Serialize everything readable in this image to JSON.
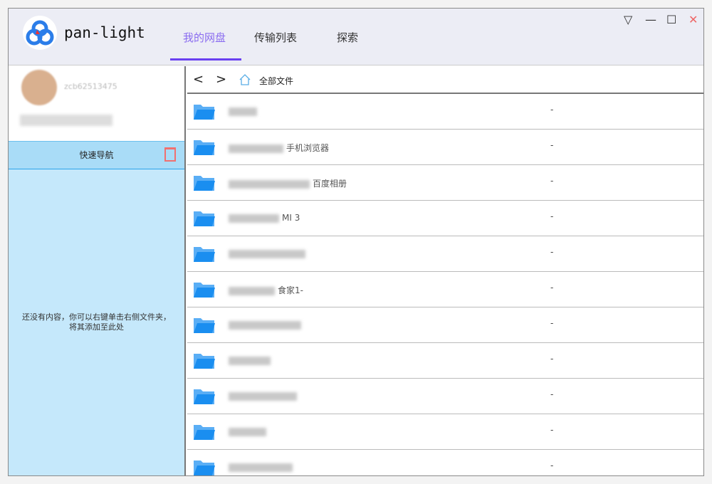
{
  "app": {
    "name": "pan-light"
  },
  "tabs": [
    {
      "label": "我的网盘"
    },
    {
      "label": "传输列表"
    },
    {
      "label": "探索"
    }
  ],
  "window_controls": {
    "menu": "▽",
    "minimize": "—",
    "maximize": "☐",
    "close": "✕"
  },
  "user": {
    "name": "zcb62513475"
  },
  "quick_nav": {
    "title": "快速导航",
    "empty_line1": "还没有内容，你可以右键单击右侧文件夹，",
    "empty_line2": "将其添加至此处"
  },
  "nav": {
    "back": "<",
    "forward": ">",
    "breadcrumb": "全部文件"
  },
  "files": [
    {
      "name": "",
      "size": "-"
    },
    {
      "name": "手机浏览器",
      "size": "-"
    },
    {
      "name": "百度相册",
      "size": "-"
    },
    {
      "name": "MI 3",
      "size": "-"
    },
    {
      "name": "",
      "size": "-"
    },
    {
      "name": "食家1-",
      "size": "-"
    },
    {
      "name": "",
      "size": "-"
    },
    {
      "name": "",
      "size": "-"
    },
    {
      "name": "",
      "size": "-"
    },
    {
      "name": "",
      "size": "-"
    },
    {
      "name": "",
      "size": "-"
    }
  ],
  "colors": {
    "accent": "#6a40f0",
    "folder": "#1a8ef0",
    "sidebar": "#c5e8fb"
  }
}
